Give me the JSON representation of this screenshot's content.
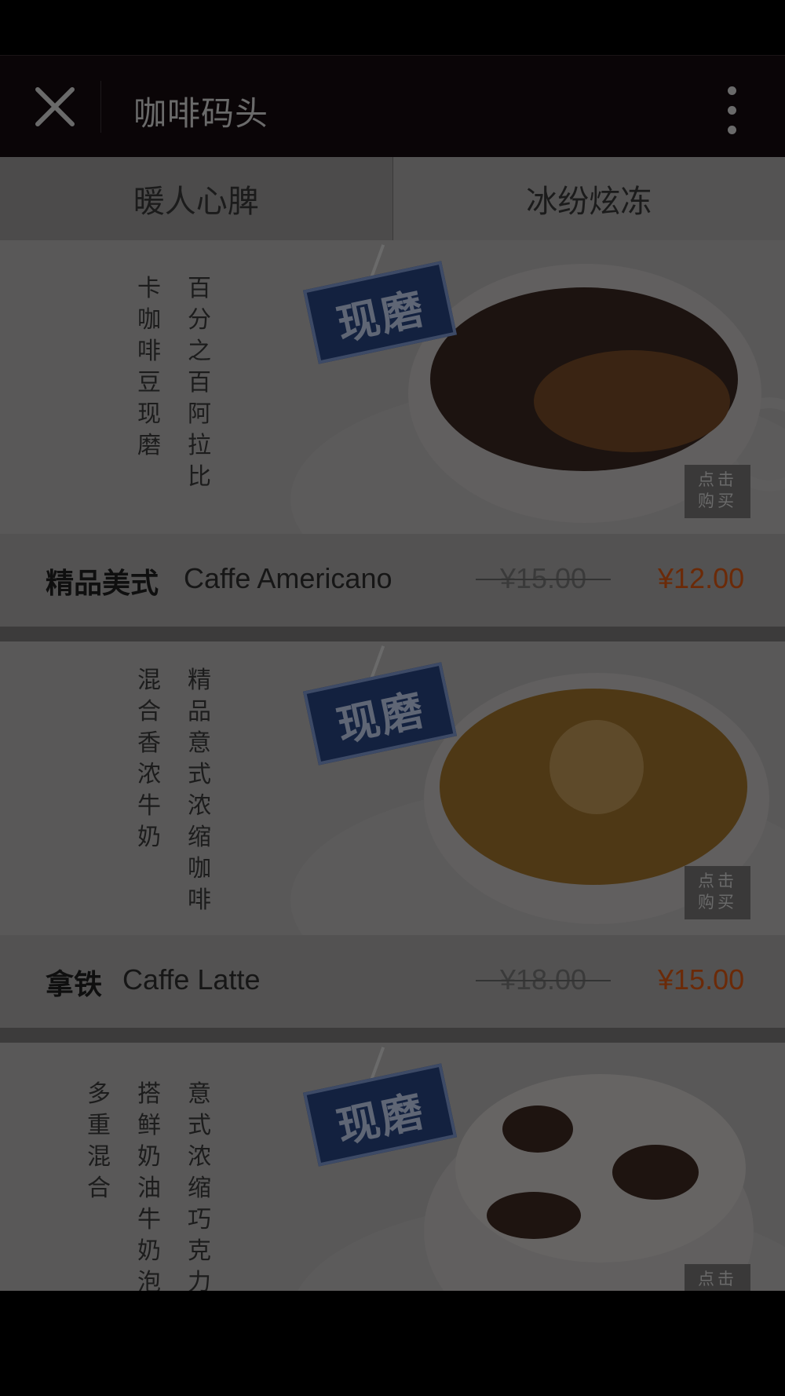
{
  "header": {
    "title": "咖啡码头",
    "close_icon": "close-icon",
    "more_icon": "more-vertical-icon"
  },
  "tabs": [
    {
      "label": "暖人心脾",
      "active": true
    },
    {
      "label": "冰纷炫冻",
      "active": false
    }
  ],
  "products": [
    {
      "calligraphy": [
        "百分之百阿拉比",
        "卡咖啡豆现磨"
      ],
      "stamp": "现磨",
      "buy_badge": [
        "点击",
        "购买"
      ],
      "name_zh": "精品美式",
      "name_en": "Caffe Americano",
      "old_price": "¥15.00",
      "price": "¥12.00"
    },
    {
      "calligraphy": [
        "精品意式浓缩咖啡",
        "混合香浓牛奶"
      ],
      "stamp": "现磨",
      "buy_badge": [
        "点击",
        "购买"
      ],
      "name_zh": "拿铁",
      "name_en": "Caffe Latte",
      "old_price": "¥18.00",
      "price": "¥15.00"
    },
    {
      "calligraphy": [
        "意式浓缩巧克力",
        "搭鲜奶油牛奶泡",
        "多重混合"
      ],
      "stamp": "现磨",
      "buy_badge": [
        "点击"
      ]
    }
  ],
  "colors": {
    "price": "#c14a0c",
    "accent_stamp": "#1d3f86"
  }
}
